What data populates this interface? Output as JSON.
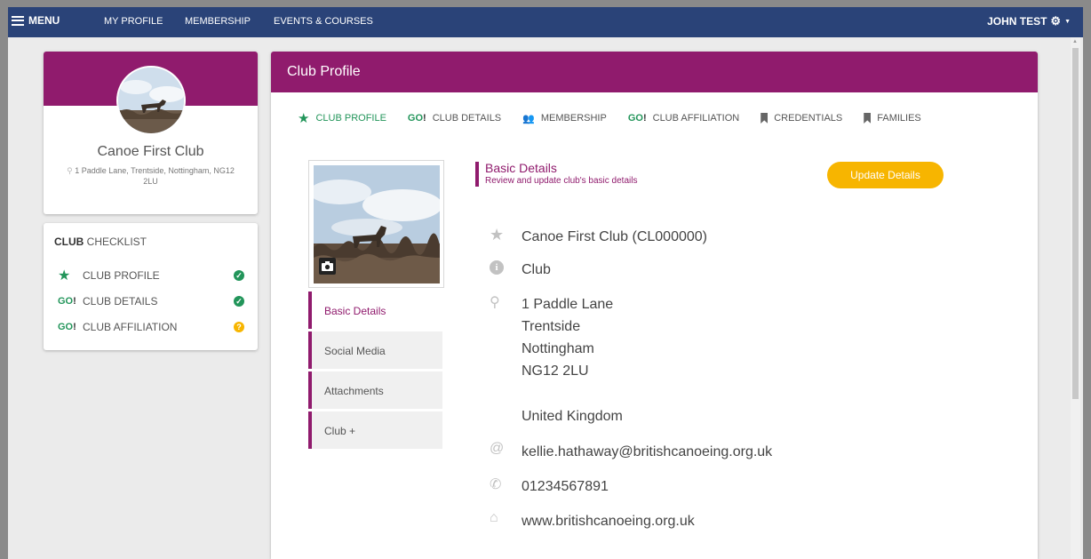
{
  "topbar": {
    "menu_label": "MENU",
    "nav": [
      "MY PROFILE",
      "MEMBERSHIP",
      "EVENTS & COURSES"
    ],
    "user_name": "JOHN TEST"
  },
  "profile": {
    "club_name": "Canoe First Club",
    "address": "1 Paddle Lane, Trentside, Nottingham, NG12 2LU"
  },
  "checklist": {
    "title_bold": "CLUB",
    "title_rest": " CHECKLIST",
    "items": [
      {
        "label": "CLUB PROFILE",
        "status": "complete"
      },
      {
        "label": "CLUB DETAILS",
        "status": "complete"
      },
      {
        "label": "CLUB AFFILIATION",
        "status": "pending"
      }
    ]
  },
  "main": {
    "header": "Club Profile",
    "tabs": [
      {
        "label": "CLUB PROFILE",
        "icon": "star-icon"
      },
      {
        "label": "CLUB DETAILS",
        "icon": "go-icon"
      },
      {
        "label": "MEMBERSHIP",
        "icon": "people-icon"
      },
      {
        "label": "CLUB AFFILIATION",
        "icon": "go-icon"
      },
      {
        "label": "CREDENTIALS",
        "icon": "bookmark-icon"
      },
      {
        "label": "FAMILIES",
        "icon": "bookmark-icon"
      }
    ],
    "go_text": "GO!",
    "sidenav": [
      "Basic Details",
      "Social Media",
      "Attachments",
      "Club +"
    ],
    "section_title": "Basic Details",
    "section_subtitle": "Review and update club's basic details",
    "update_button": "Update Details",
    "details": {
      "name": "Canoe First Club (CL000000)",
      "type": "Club",
      "address_lines": [
        "1 Paddle Lane",
        "Trentside",
        "Nottingham",
        "NG12 2LU"
      ],
      "country": "United Kingdom",
      "email": "kellie.hathaway@britishcanoeing.org.uk",
      "phone": "01234567891",
      "website": "www.britishcanoeing.org.uk"
    }
  },
  "colors": {
    "nav_blue": "#2a4378",
    "brand_purple": "#901b6d",
    "accent_green": "#22955a",
    "button_yellow": "#f7b500"
  }
}
